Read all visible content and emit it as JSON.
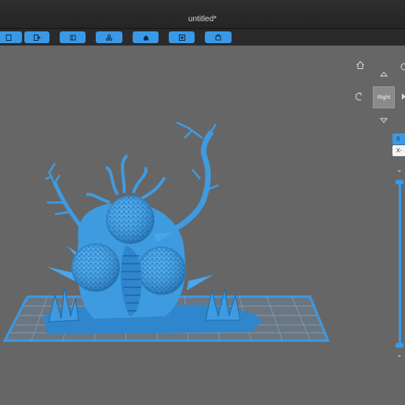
{
  "window": {
    "title": "untitled*"
  },
  "toolbar": {
    "buttons": [
      {
        "icon": "open-file-icon"
      },
      {
        "icon": "export-icon"
      },
      {
        "icon": "layers-icon"
      },
      {
        "icon": "supports-icon"
      },
      {
        "icon": "home-icon"
      },
      {
        "icon": "frame-icon"
      },
      {
        "icon": "print-icon"
      }
    ]
  },
  "view": {
    "cube_label": "Right",
    "mode_chip": "S",
    "axis_chip": "X-",
    "layer_slider": {
      "position": 1.0
    }
  },
  "colors": {
    "accent": "#3a99e6",
    "model": "#3f9be0",
    "viewport": "#666666"
  }
}
